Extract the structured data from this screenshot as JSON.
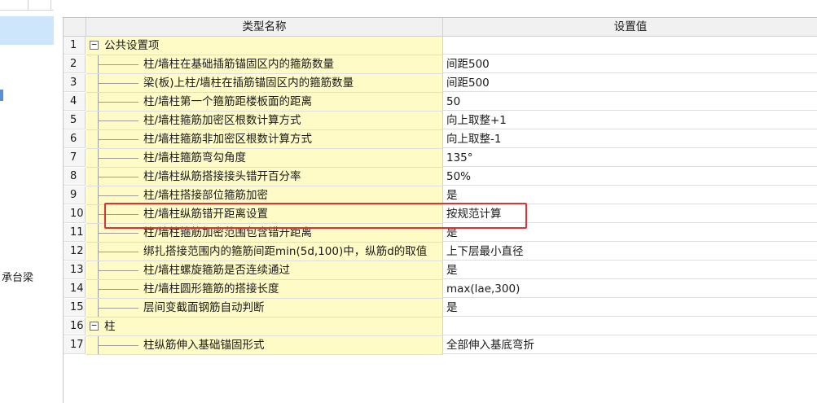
{
  "sidebar": {
    "label": "承台梁"
  },
  "table": {
    "col_name": "类型名称",
    "col_value": "设置值",
    "rows": [
      {
        "num": "1",
        "name": "公共设置项",
        "value": "",
        "group": true
      },
      {
        "num": "2",
        "name": "柱/墙柱在基础插筋锚固区内的箍筋数量",
        "value": "间距500"
      },
      {
        "num": "3",
        "name": "梁(板)上柱/墙柱在插筋锚固区内的箍筋数量",
        "value": "间距500"
      },
      {
        "num": "4",
        "name": "柱/墙柱第一个箍筋距楼板面的距离",
        "value": "50"
      },
      {
        "num": "5",
        "name": "柱/墙柱箍筋加密区根数计算方式",
        "value": "向上取整+1"
      },
      {
        "num": "6",
        "name": "柱/墙柱箍筋非加密区根数计算方式",
        "value": "向上取整-1"
      },
      {
        "num": "7",
        "name": "柱/墙柱箍筋弯勾角度",
        "value": "135°"
      },
      {
        "num": "8",
        "name": "柱/墙柱纵筋搭接接头错开百分率",
        "value": "50%"
      },
      {
        "num": "9",
        "name": "柱/墙柱搭接部位箍筋加密",
        "value": "是"
      },
      {
        "num": "10",
        "name": "柱/墙柱纵筋错开距离设置",
        "value": "按规范计算"
      },
      {
        "num": "11",
        "name": "柱/墙柱箍筋加密范围包含错开距离",
        "value": "是"
      },
      {
        "num": "12",
        "name": "绑扎搭接范围内的箍筋间距min(5d,100)中，纵筋d的取值",
        "value": "上下层最小直径"
      },
      {
        "num": "13",
        "name": "柱/墙柱螺旋箍筋是否连续通过",
        "value": "是"
      },
      {
        "num": "14",
        "name": "柱/墙柱圆形箍筋的搭接长度",
        "value": "max(lae,300)"
      },
      {
        "num": "15",
        "name": "层间变截面钢筋自动判断",
        "value": "是"
      },
      {
        "num": "16",
        "name": "柱",
        "value": "",
        "group": true
      },
      {
        "num": "17",
        "name": "柱纵筋伸入基础锚固形式",
        "value": "全部伸入基底弯折"
      }
    ]
  },
  "colors": {
    "name_bg": "#fffbc7",
    "highlight": "#d9343a",
    "selected": "#cde6fb"
  }
}
